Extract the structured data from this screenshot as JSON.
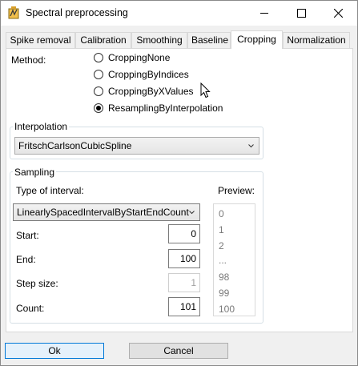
{
  "window": {
    "title": "Spectral preprocessing",
    "controls": {
      "minimize_icon": "minimize-icon",
      "maximize_icon": "maximize-icon",
      "close_icon": "close-icon"
    }
  },
  "tabs": [
    {
      "label": "Spike removal",
      "active": false
    },
    {
      "label": "Calibration",
      "active": false
    },
    {
      "label": "Smoothing",
      "active": false
    },
    {
      "label": "Baseline",
      "active": false
    },
    {
      "label": "Cropping",
      "active": true
    },
    {
      "label": "Normalization",
      "active": false
    }
  ],
  "method": {
    "label": "Method:",
    "options": [
      {
        "label": "CroppingNone",
        "selected": false
      },
      {
        "label": "CroppingByIndices",
        "selected": false
      },
      {
        "label": "CroppingByXValues",
        "selected": false
      },
      {
        "label": "ResamplingByInterpolation",
        "selected": true
      }
    ]
  },
  "interpolation": {
    "group_label": "Interpolation",
    "selected": "FritschCarlsonCubicSpline"
  },
  "sampling": {
    "group_label": "Sampling",
    "type_label": "Type of interval:",
    "type_selected": "LinearlySpacedIntervalByStartEndCount",
    "preview_label": "Preview:",
    "start_label": "Start:",
    "start_value": "0",
    "end_label": "End:",
    "end_value": "100",
    "step_label": "Step size:",
    "step_value": "1",
    "count_label": "Count:",
    "count_value": "101",
    "preview_items": [
      "0",
      "1",
      "2",
      "...",
      "98",
      "99",
      "100"
    ]
  },
  "buttons": {
    "ok": "Ok",
    "cancel": "Cancel"
  }
}
